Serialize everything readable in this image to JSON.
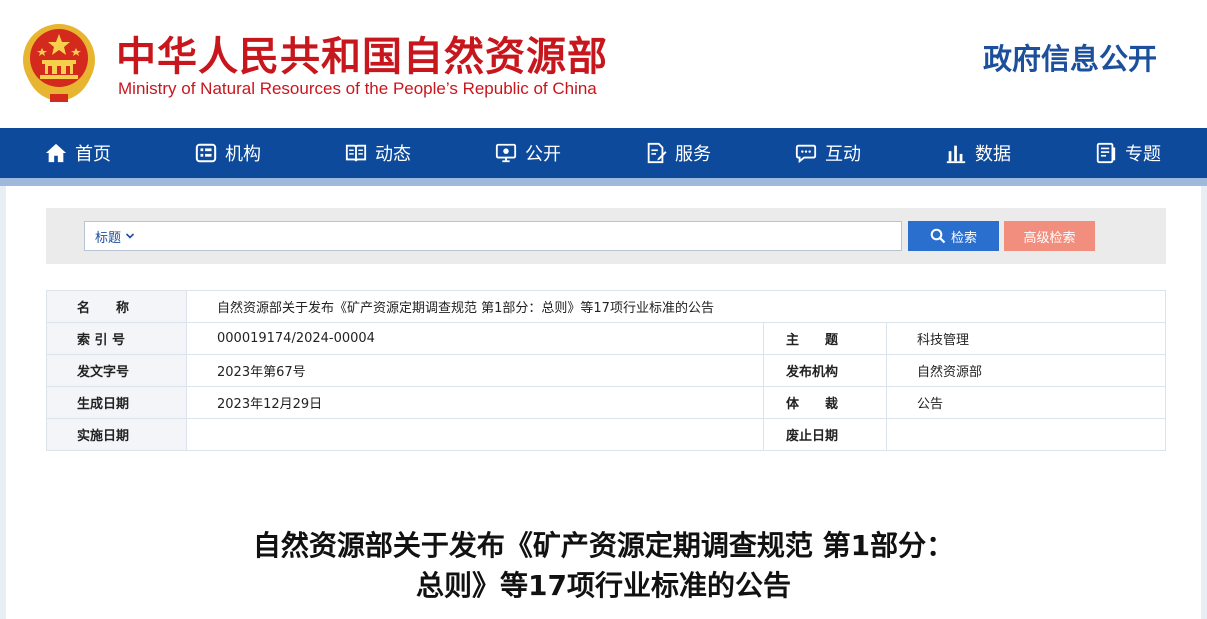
{
  "header": {
    "title_cn": "中华人民共和国自然资源部",
    "title_en": "Ministry of Natural Resources of the People’s Republic of China",
    "gov_open": "政府信息公开"
  },
  "nav": {
    "items": [
      {
        "label": "首页",
        "icon": "home-icon"
      },
      {
        "label": "机构",
        "icon": "org-icon"
      },
      {
        "label": "动态",
        "icon": "book-icon"
      },
      {
        "label": "公开",
        "icon": "monitor-icon"
      },
      {
        "label": "服务",
        "icon": "edit-doc-icon"
      },
      {
        "label": "互动",
        "icon": "chat-icon"
      },
      {
        "label": "数据",
        "icon": "bar-chart-icon"
      },
      {
        "label": "专题",
        "icon": "list-doc-icon"
      }
    ]
  },
  "search": {
    "type_label": "标题",
    "placeholder": "",
    "search_label": "检索",
    "advanced_label": "高级检索"
  },
  "meta": {
    "name_label": "名　　称",
    "name_value": "自然资源部关于发布《矿产资源定期调查规范 第1部分：总则》等17项行业标准的公告",
    "index_label": "索 引 号",
    "index_value": "000019174/2024-00004",
    "topic_label": "主　　题",
    "topic_value": "科技管理",
    "doc_no_label": "发文字号",
    "doc_no_value": "2023年第67号",
    "publisher_label": "发布机构",
    "publisher_value": "自然资源部",
    "date_label": "生成日期",
    "date_value": "2023年12月29日",
    "genre_label": "体　　裁",
    "genre_value": "公告",
    "effective_label": "实施日期",
    "effective_value": "",
    "expire_label": "废止日期",
    "expire_value": ""
  },
  "article": {
    "title_line1": "自然资源部关于发布《矿产资源定期调查规范 第1部分：",
    "title_line2": "总则》等17项行业标准的公告"
  },
  "colors": {
    "brand_red": "#c8161d",
    "nav_blue": "#0d4a9c",
    "search_blue": "#2a6fce",
    "advanced_salmon": "#f28e7e"
  }
}
